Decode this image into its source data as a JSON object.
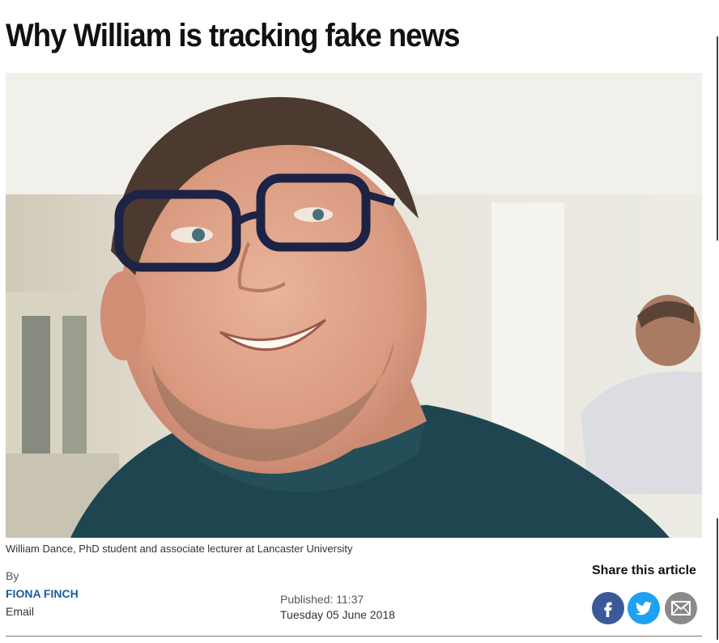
{
  "article": {
    "headline": "Why William is tracking fake news",
    "caption": "William Dance, PhD student and associate lecturer at Lancaster University",
    "byline_label": "By",
    "author": "FIONA FINCH",
    "email_label": "Email",
    "published_label": "Published: 11:37",
    "published_date": "Tuesday 05 June 2018"
  },
  "share": {
    "title": "Share this article",
    "buttons": [
      {
        "icon": "facebook-icon",
        "color": "#3b5998"
      },
      {
        "icon": "twitter-icon",
        "color": "#1da1f2"
      },
      {
        "icon": "envelope-icon",
        "color": "#8a8a8a"
      }
    ]
  }
}
